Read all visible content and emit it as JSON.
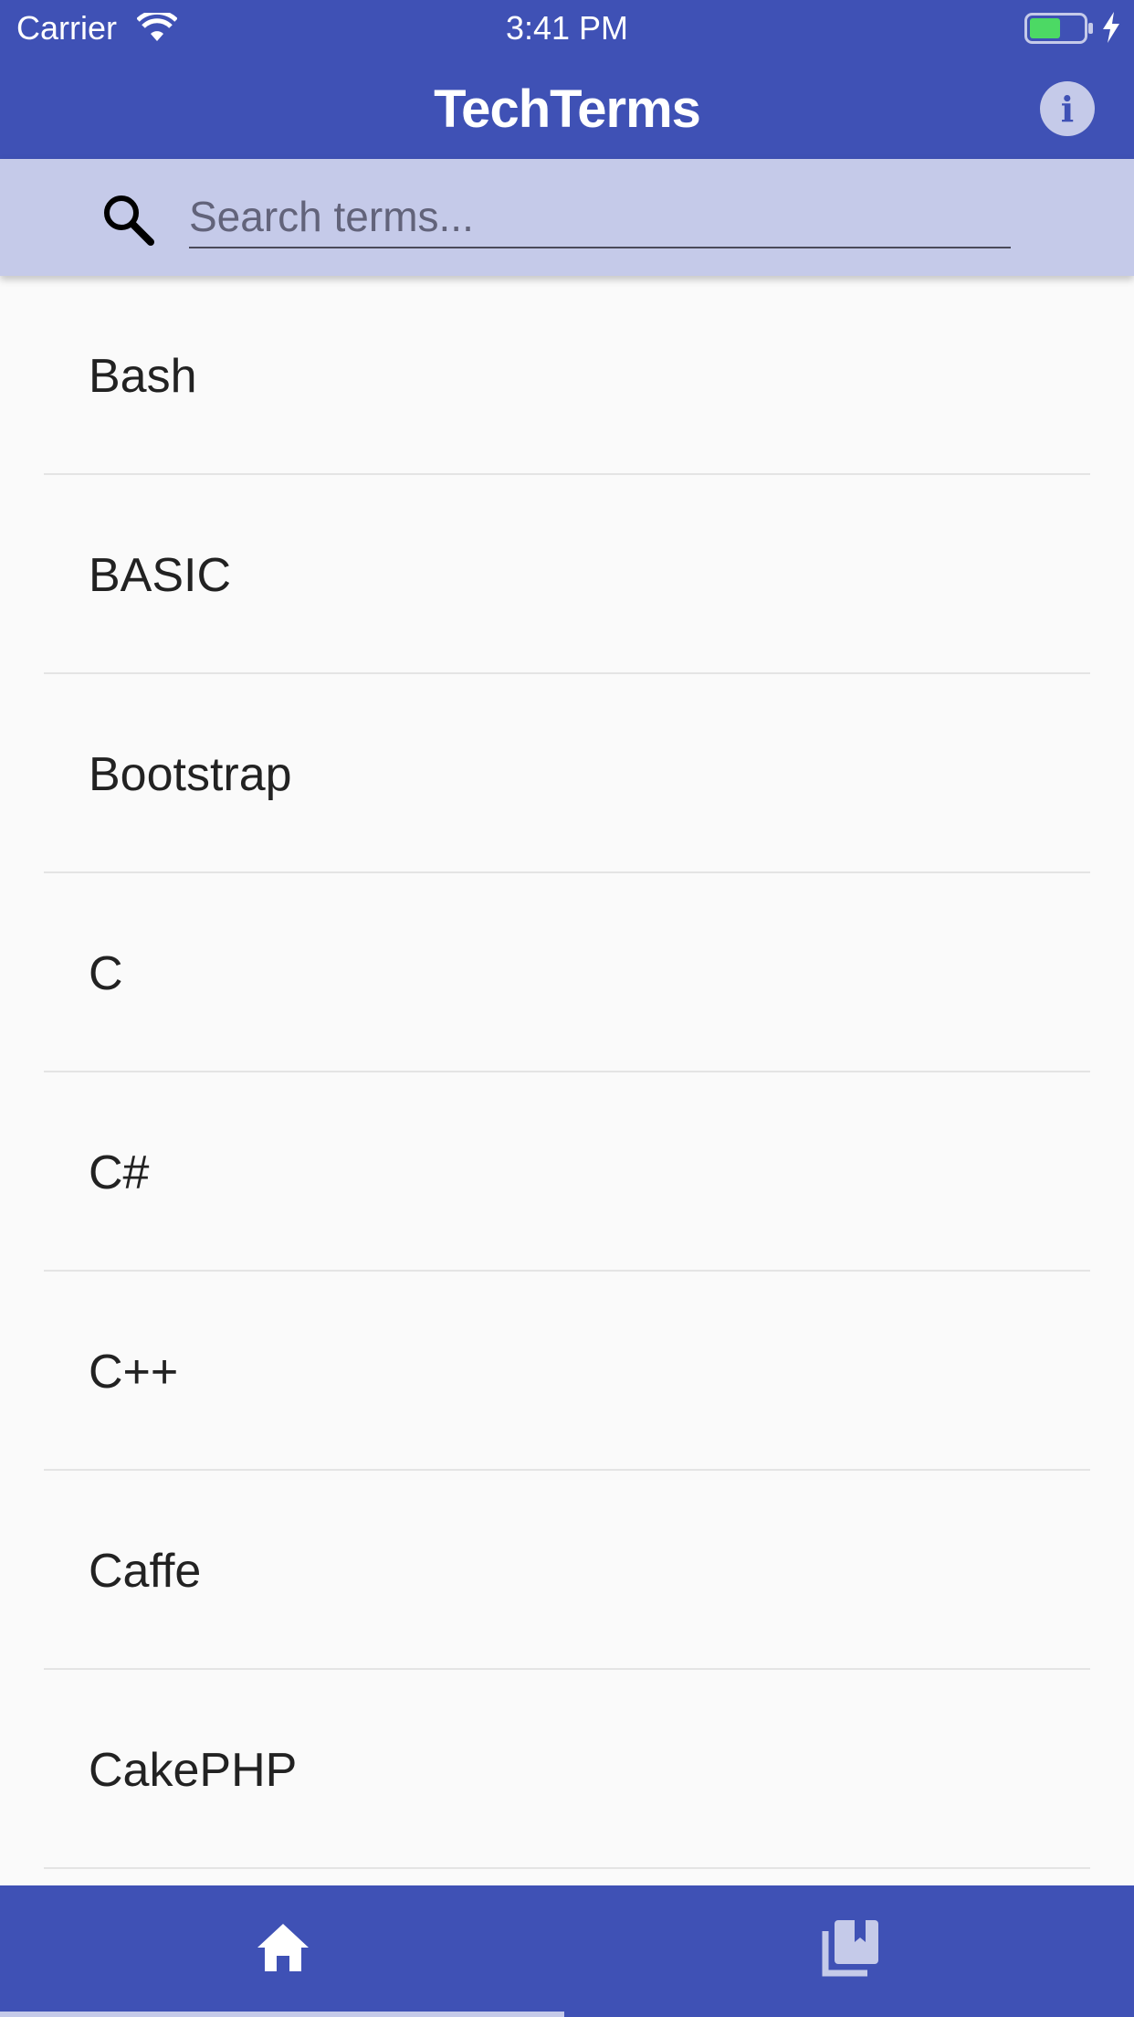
{
  "status_bar": {
    "carrier": "Carrier",
    "time": "3:41 PM"
  },
  "app_bar": {
    "title": "TechTerms",
    "info_icon": "info-icon"
  },
  "search": {
    "placeholder": "Search terms...",
    "value": ""
  },
  "terms": [
    {
      "label": "Bash"
    },
    {
      "label": "BASIC"
    },
    {
      "label": "Bootstrap"
    },
    {
      "label": "C"
    },
    {
      "label": "C#"
    },
    {
      "label": "C++"
    },
    {
      "label": "Caffe"
    },
    {
      "label": "CakePHP"
    }
  ],
  "bottom_nav": [
    {
      "icon": "home-icon",
      "active": true
    },
    {
      "icon": "library-books-icon",
      "active": false
    }
  ],
  "colors": {
    "primary": "#3f51b5",
    "primary_light": "#c5cae9",
    "background": "#fafafa",
    "divider": "#e4e4e4"
  }
}
